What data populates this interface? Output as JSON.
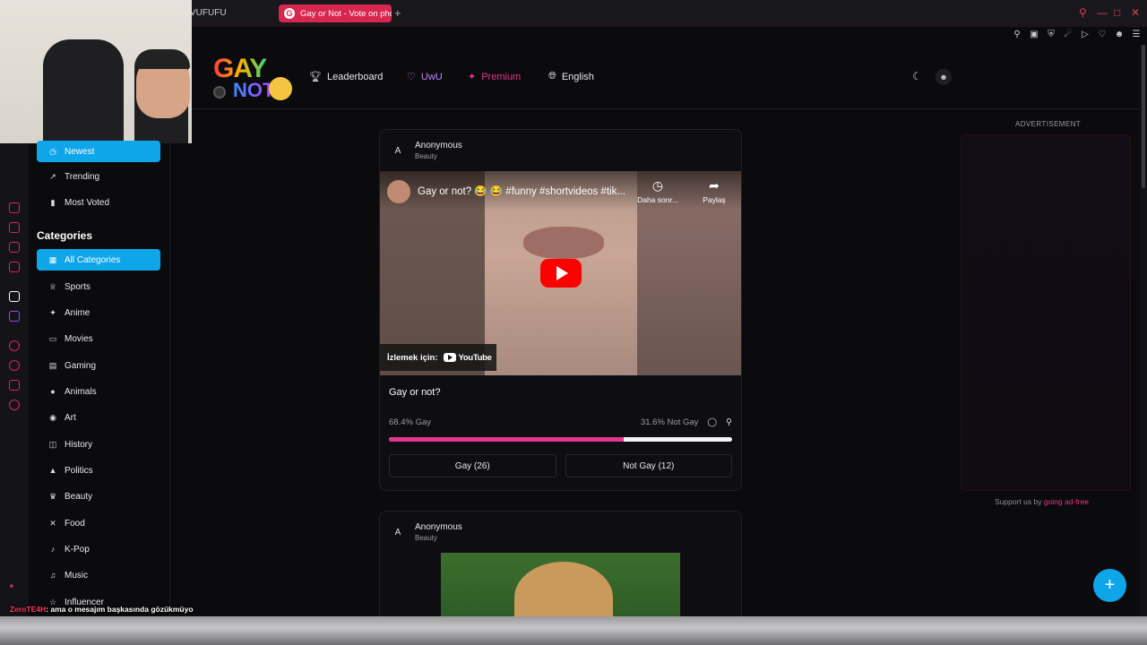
{
  "browser": {
    "prev_tab_title": "VUFUFU",
    "active_tab_title": "Gay or Not - Vote on phot",
    "new_tab_icon": "+",
    "favicon_letter": "G"
  },
  "header": {
    "logo_line1": "GAY",
    "logo_line2": "NOT",
    "nav": {
      "leaderboard": "Leaderboard",
      "uwu": "UwU",
      "premium": "Premium",
      "language": "English"
    }
  },
  "sidebar": {
    "sort_items": [
      {
        "label": "Newest",
        "icon": "clock-icon",
        "active": true
      },
      {
        "label": "Trending",
        "icon": "trending-icon",
        "active": false
      },
      {
        "label": "Most Voted",
        "icon": "bar-chart-icon",
        "active": false
      }
    ],
    "categories_heading": "Categories",
    "categories": [
      {
        "label": "All Categories",
        "icon": "grid-icon",
        "active": true
      },
      {
        "label": "Sports",
        "icon": "trophy-icon",
        "active": false
      },
      {
        "label": "Anime",
        "icon": "sparkle-icon",
        "active": false
      },
      {
        "label": "Movies",
        "icon": "tv-icon",
        "active": false
      },
      {
        "label": "Gaming",
        "icon": "gamepad-icon",
        "active": false
      },
      {
        "label": "Animals",
        "icon": "paw-icon",
        "active": false
      },
      {
        "label": "Art",
        "icon": "palette-icon",
        "active": false
      },
      {
        "label": "History",
        "icon": "book-icon",
        "active": false
      },
      {
        "label": "Politics",
        "icon": "landmark-icon",
        "active": false
      },
      {
        "label": "Beauty",
        "icon": "crown-icon",
        "active": false
      },
      {
        "label": "Food",
        "icon": "utensils-icon",
        "active": false
      },
      {
        "label": "K-Pop",
        "icon": "music-note-icon",
        "active": false
      },
      {
        "label": "Music",
        "icon": "music-icon",
        "active": false
      },
      {
        "label": "Influencer",
        "icon": "star-icon",
        "active": false
      }
    ]
  },
  "posts": [
    {
      "avatar_letter": "A",
      "author": "Anonymous",
      "category": "Beauty",
      "video": {
        "title": "Gay or not? 😂 😂 #funny #shortvideos #tik...",
        "watch_later": "Daha sonr...",
        "share": "Paylaş",
        "watch_on": "İzlemek için:",
        "youtube": "YouTube"
      },
      "question": "Gay or not?",
      "gay_percent_label": "68.4% Gay",
      "not_gay_percent_label": "31.6% Not Gay",
      "gay_fraction": 0.684,
      "gay_button": "Gay (26)",
      "not_gay_button": "Not Gay (12)"
    },
    {
      "avatar_letter": "A",
      "author": "Anonymous",
      "category": "Beauty"
    }
  ],
  "ad": {
    "label": "ADVERTISEMENT",
    "support_prefix": "Support us by",
    "support_link": "going ad-free"
  },
  "chat": {
    "user": "ZeroTE4H",
    "message": ": ama o mesajım başkasında gözükmüyo"
  },
  "colors": {
    "accent": "#0ea5e9",
    "vote_bar": "#e0368c",
    "tab_active": "#d9264f",
    "uwu": "#c084fc",
    "premium": "#e0368c"
  }
}
